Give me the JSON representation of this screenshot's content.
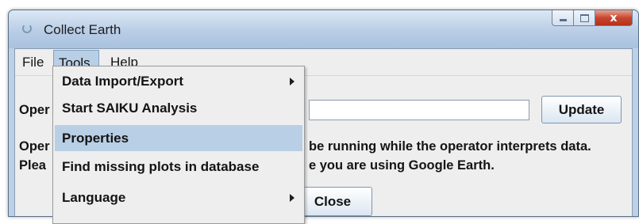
{
  "window": {
    "title": "Collect Earth",
    "close_glyph": "x"
  },
  "menubar": [
    {
      "label": "File"
    },
    {
      "label": "Tools"
    },
    {
      "label": "Help"
    }
  ],
  "tools_menu": {
    "items": [
      {
        "label": "Data Import/Export",
        "has_submenu": true
      },
      {
        "label": "Start SAIKU Analysis",
        "has_submenu": false
      },
      {
        "label": "Properties",
        "has_submenu": false,
        "highlighted": true
      },
      {
        "label": "Find missing plots in database",
        "has_submenu": false
      },
      {
        "label": "Language",
        "has_submenu": true
      }
    ]
  },
  "content": {
    "operator_label_fragment": "Oper",
    "operator_input_value": "",
    "update_button": "Update",
    "info_line1_left": "Oper",
    "info_line1_right": "be running while the operator interprets data.",
    "info_line2_left": "Plea",
    "info_line2_right": "e you are using Google Earth.",
    "close_button": "Close"
  },
  "colors": {
    "menu_highlight": "#b8cfe5",
    "window_frame": "#bcd0e8",
    "close_button": "#c8462f"
  }
}
